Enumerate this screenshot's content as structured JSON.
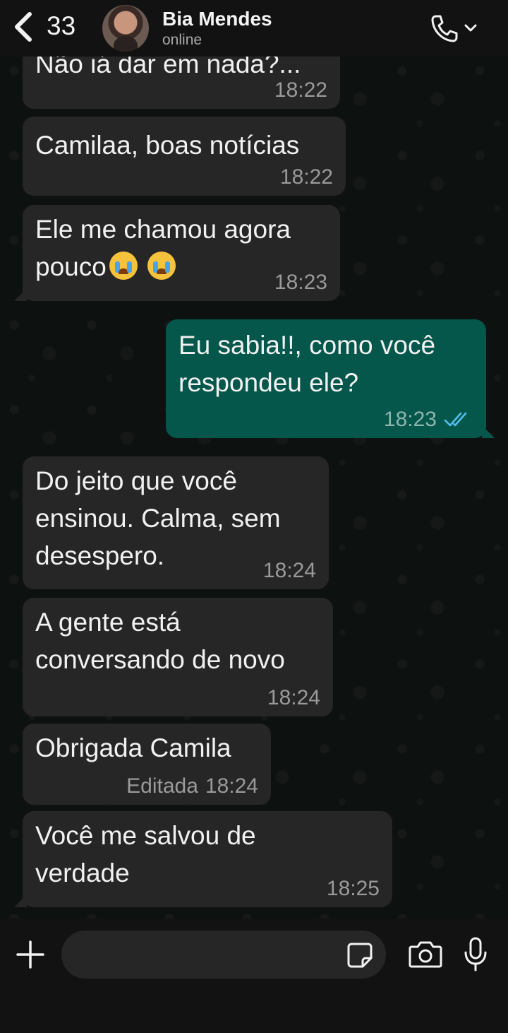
{
  "header": {
    "back_count": "33",
    "contact_name": "Bia Mendes",
    "contact_status": "online",
    "icons": [
      "chevron-left-icon",
      "phone-icon",
      "chevron-down-icon"
    ]
  },
  "messages": [
    {
      "direction": "in",
      "text": "Não iá dar em nada?...",
      "time": "18:22"
    },
    {
      "direction": "in",
      "text": "Camilaa, boas notícias",
      "time": "18:22"
    },
    {
      "direction": "in",
      "text": "Ele me chamou agora\npouco",
      "emoji": "loudly-crying-face x2",
      "time": "18:23"
    },
    {
      "direction": "out",
      "text": "Eu sabia!!, como você\nrespondeu ele?",
      "time": "18:23",
      "status": "read"
    },
    {
      "direction": "in",
      "text": "Do jeito que você\nensinou. Calma, sem\ndesespero.",
      "time": "18:24"
    },
    {
      "direction": "in",
      "text": "A gente está\nconversando de novo",
      "time": "18:24"
    },
    {
      "direction": "in",
      "text": "Obrigada Camila",
      "edited_label": "Editada",
      "time": "18:24"
    },
    {
      "direction": "in",
      "text": "Você me salvou de\nverdade",
      "time": "18:25"
    }
  ],
  "composer": {
    "placeholder": "",
    "icons": [
      "plus-icon",
      "sticker-icon",
      "camera-icon",
      "microphone-icon"
    ]
  },
  "colors": {
    "incoming_bubble": "#262626",
    "outgoing_bubble": "#05574b",
    "read_ticks": "#53bdeb",
    "header_bg": "#121212"
  }
}
